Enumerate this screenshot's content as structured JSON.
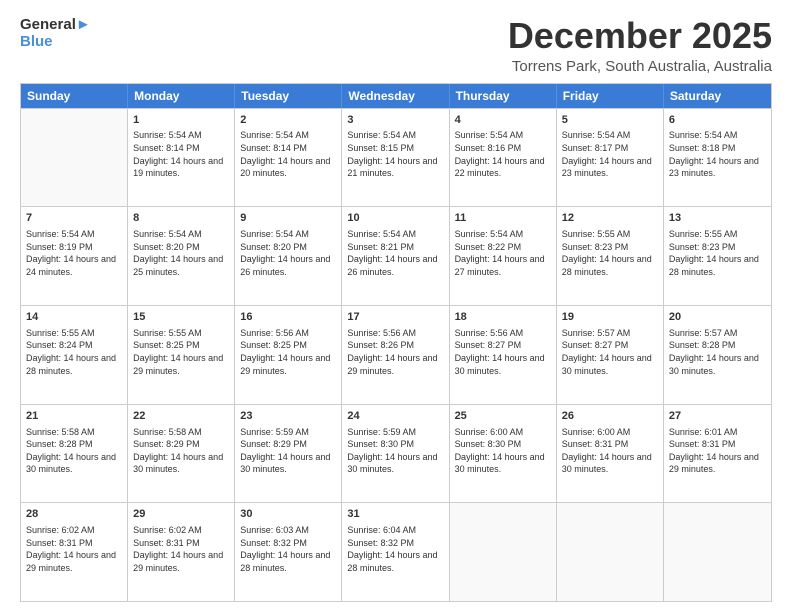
{
  "logo": {
    "line1": "General",
    "line2": "Blue"
  },
  "title": "December 2025",
  "subtitle": "Torrens Park, South Australia, Australia",
  "header_days": [
    "Sunday",
    "Monday",
    "Tuesday",
    "Wednesday",
    "Thursday",
    "Friday",
    "Saturday"
  ],
  "weeks": [
    [
      {
        "day": "",
        "sunrise": "",
        "sunset": "",
        "daylight": ""
      },
      {
        "day": "1",
        "sunrise": "Sunrise: 5:54 AM",
        "sunset": "Sunset: 8:14 PM",
        "daylight": "Daylight: 14 hours and 19 minutes."
      },
      {
        "day": "2",
        "sunrise": "Sunrise: 5:54 AM",
        "sunset": "Sunset: 8:14 PM",
        "daylight": "Daylight: 14 hours and 20 minutes."
      },
      {
        "day": "3",
        "sunrise": "Sunrise: 5:54 AM",
        "sunset": "Sunset: 8:15 PM",
        "daylight": "Daylight: 14 hours and 21 minutes."
      },
      {
        "day": "4",
        "sunrise": "Sunrise: 5:54 AM",
        "sunset": "Sunset: 8:16 PM",
        "daylight": "Daylight: 14 hours and 22 minutes."
      },
      {
        "day": "5",
        "sunrise": "Sunrise: 5:54 AM",
        "sunset": "Sunset: 8:17 PM",
        "daylight": "Daylight: 14 hours and 23 minutes."
      },
      {
        "day": "6",
        "sunrise": "Sunrise: 5:54 AM",
        "sunset": "Sunset: 8:18 PM",
        "daylight": "Daylight: 14 hours and 23 minutes."
      }
    ],
    [
      {
        "day": "7",
        "sunrise": "Sunrise: 5:54 AM",
        "sunset": "Sunset: 8:19 PM",
        "daylight": "Daylight: 14 hours and 24 minutes."
      },
      {
        "day": "8",
        "sunrise": "Sunrise: 5:54 AM",
        "sunset": "Sunset: 8:20 PM",
        "daylight": "Daylight: 14 hours and 25 minutes."
      },
      {
        "day": "9",
        "sunrise": "Sunrise: 5:54 AM",
        "sunset": "Sunset: 8:20 PM",
        "daylight": "Daylight: 14 hours and 26 minutes."
      },
      {
        "day": "10",
        "sunrise": "Sunrise: 5:54 AM",
        "sunset": "Sunset: 8:21 PM",
        "daylight": "Daylight: 14 hours and 26 minutes."
      },
      {
        "day": "11",
        "sunrise": "Sunrise: 5:54 AM",
        "sunset": "Sunset: 8:22 PM",
        "daylight": "Daylight: 14 hours and 27 minutes."
      },
      {
        "day": "12",
        "sunrise": "Sunrise: 5:55 AM",
        "sunset": "Sunset: 8:23 PM",
        "daylight": "Daylight: 14 hours and 28 minutes."
      },
      {
        "day": "13",
        "sunrise": "Sunrise: 5:55 AM",
        "sunset": "Sunset: 8:23 PM",
        "daylight": "Daylight: 14 hours and 28 minutes."
      }
    ],
    [
      {
        "day": "14",
        "sunrise": "Sunrise: 5:55 AM",
        "sunset": "Sunset: 8:24 PM",
        "daylight": "Daylight: 14 hours and 28 minutes."
      },
      {
        "day": "15",
        "sunrise": "Sunrise: 5:55 AM",
        "sunset": "Sunset: 8:25 PM",
        "daylight": "Daylight: 14 hours and 29 minutes."
      },
      {
        "day": "16",
        "sunrise": "Sunrise: 5:56 AM",
        "sunset": "Sunset: 8:25 PM",
        "daylight": "Daylight: 14 hours and 29 minutes."
      },
      {
        "day": "17",
        "sunrise": "Sunrise: 5:56 AM",
        "sunset": "Sunset: 8:26 PM",
        "daylight": "Daylight: 14 hours and 29 minutes."
      },
      {
        "day": "18",
        "sunrise": "Sunrise: 5:56 AM",
        "sunset": "Sunset: 8:27 PM",
        "daylight": "Daylight: 14 hours and 30 minutes."
      },
      {
        "day": "19",
        "sunrise": "Sunrise: 5:57 AM",
        "sunset": "Sunset: 8:27 PM",
        "daylight": "Daylight: 14 hours and 30 minutes."
      },
      {
        "day": "20",
        "sunrise": "Sunrise: 5:57 AM",
        "sunset": "Sunset: 8:28 PM",
        "daylight": "Daylight: 14 hours and 30 minutes."
      }
    ],
    [
      {
        "day": "21",
        "sunrise": "Sunrise: 5:58 AM",
        "sunset": "Sunset: 8:28 PM",
        "daylight": "Daylight: 14 hours and 30 minutes."
      },
      {
        "day": "22",
        "sunrise": "Sunrise: 5:58 AM",
        "sunset": "Sunset: 8:29 PM",
        "daylight": "Daylight: 14 hours and 30 minutes."
      },
      {
        "day": "23",
        "sunrise": "Sunrise: 5:59 AM",
        "sunset": "Sunset: 8:29 PM",
        "daylight": "Daylight: 14 hours and 30 minutes."
      },
      {
        "day": "24",
        "sunrise": "Sunrise: 5:59 AM",
        "sunset": "Sunset: 8:30 PM",
        "daylight": "Daylight: 14 hours and 30 minutes."
      },
      {
        "day": "25",
        "sunrise": "Sunrise: 6:00 AM",
        "sunset": "Sunset: 8:30 PM",
        "daylight": "Daylight: 14 hours and 30 minutes."
      },
      {
        "day": "26",
        "sunrise": "Sunrise: 6:00 AM",
        "sunset": "Sunset: 8:31 PM",
        "daylight": "Daylight: 14 hours and 30 minutes."
      },
      {
        "day": "27",
        "sunrise": "Sunrise: 6:01 AM",
        "sunset": "Sunset: 8:31 PM",
        "daylight": "Daylight: 14 hours and 29 minutes."
      }
    ],
    [
      {
        "day": "28",
        "sunrise": "Sunrise: 6:02 AM",
        "sunset": "Sunset: 8:31 PM",
        "daylight": "Daylight: 14 hours and 29 minutes."
      },
      {
        "day": "29",
        "sunrise": "Sunrise: 6:02 AM",
        "sunset": "Sunset: 8:31 PM",
        "daylight": "Daylight: 14 hours and 29 minutes."
      },
      {
        "day": "30",
        "sunrise": "Sunrise: 6:03 AM",
        "sunset": "Sunset: 8:32 PM",
        "daylight": "Daylight: 14 hours and 28 minutes."
      },
      {
        "day": "31",
        "sunrise": "Sunrise: 6:04 AM",
        "sunset": "Sunset: 8:32 PM",
        "daylight": "Daylight: 14 hours and 28 minutes."
      },
      {
        "day": "",
        "sunrise": "",
        "sunset": "",
        "daylight": ""
      },
      {
        "day": "",
        "sunrise": "",
        "sunset": "",
        "daylight": ""
      },
      {
        "day": "",
        "sunrise": "",
        "sunset": "",
        "daylight": ""
      }
    ]
  ]
}
